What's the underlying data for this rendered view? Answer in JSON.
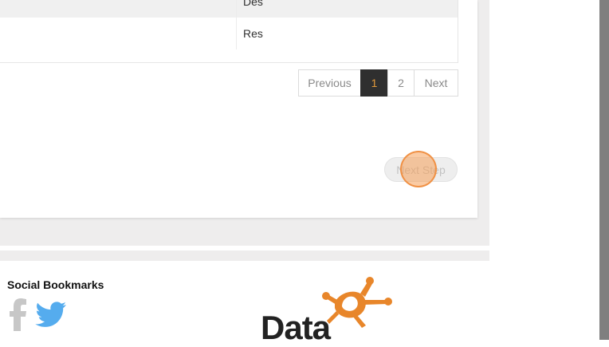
{
  "table": {
    "rows": [
      {
        "cell": "Des"
      },
      {
        "cell": "Res"
      }
    ]
  },
  "pagination": {
    "previous_label": "Previous",
    "pages": [
      "1",
      "2"
    ],
    "current_page": "1",
    "next_label": "Next"
  },
  "actions": {
    "next_step_label": "Next Step",
    "next_step_enabled": false
  },
  "footer": {
    "social_title": "Social Bookmarks",
    "social_icons": [
      "facebook-icon",
      "twitter-icon"
    ],
    "logo_text": "Data"
  },
  "colors": {
    "page_background": "#eeeded",
    "active_page_bg": "#2f2f2f",
    "active_page_fg": "#e39a3b",
    "twitter_blue": "#55acee",
    "facebook_gray": "#c7c7c7",
    "logo_orange": "#e8862a",
    "click_indicator": "#f5a05a"
  }
}
